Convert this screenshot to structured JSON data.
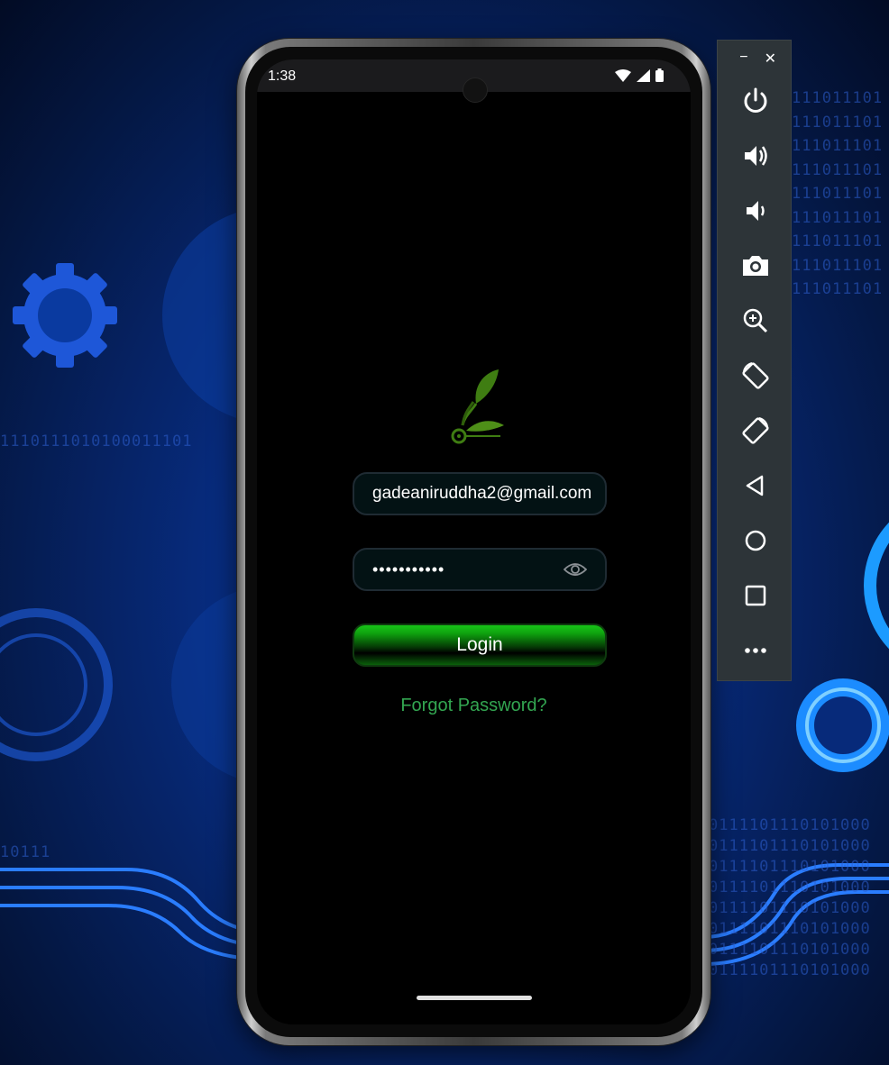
{
  "status_bar": {
    "time": "1:38"
  },
  "email_field": {
    "value": "gadeaniruddha2@gmail.com"
  },
  "password_field": {
    "value": "•••••••••••"
  },
  "login_button": {
    "label": "Login"
  },
  "forgot_password": {
    "label": "Forgot Password?"
  },
  "background": {
    "binary_left": "1110111010100011101",
    "binary_left_bottom": "10111",
    "binary_right": [
      "111011101",
      "111011101",
      "111011101",
      "111011101",
      "111011101",
      "111011101",
      "111011101",
      "111011101",
      "111011101"
    ],
    "binary_right_bottom": [
      "0111101110101000",
      "0111101110101000",
      "0111101110101000",
      "0111101110101000",
      "0111101110101000",
      "0111101110101000",
      "0111101110101000",
      "0111101110101000"
    ]
  },
  "toolbar": {
    "minimize_label": "−",
    "close_label": "✕",
    "buttons": [
      "power-icon",
      "volume-up-icon",
      "volume-down-icon",
      "camera-icon",
      "zoom-icon",
      "rotate-left-icon",
      "rotate-right-icon",
      "back-icon",
      "home-icon",
      "overview-icon",
      "more-icon"
    ]
  },
  "colors": {
    "accent_green": "#33a651",
    "toolbar_bg": "#2d3438"
  }
}
